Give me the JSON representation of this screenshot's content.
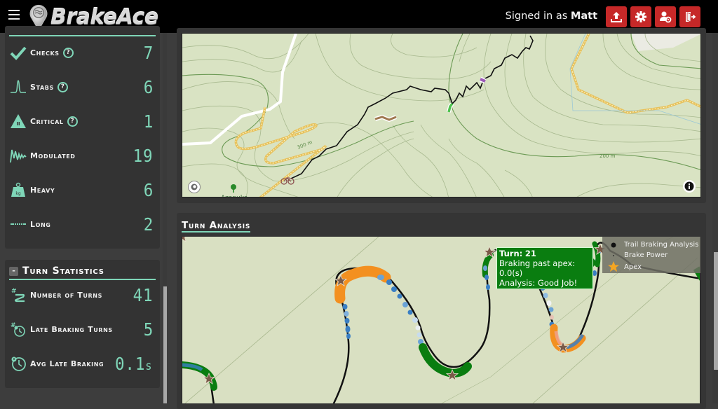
{
  "app": {
    "name": "BrakeAce",
    "signed_in_prefix": "Signed in as",
    "user": "Matt"
  },
  "toolbar": {
    "buttons": [
      {
        "name": "upload",
        "icon": "upload-icon"
      },
      {
        "name": "settings",
        "icon": "gear-icon"
      },
      {
        "name": "user-settings",
        "icon": "user-gear-icon"
      },
      {
        "name": "logout",
        "icon": "sign-out-icon"
      }
    ],
    "button_color": "#c62828"
  },
  "braking_stats": {
    "items": [
      {
        "label": "Checks",
        "value": "7",
        "icon": "checkmark-icon",
        "help": true
      },
      {
        "label": "Stabs",
        "value": "6",
        "icon": "spike-icon",
        "help": true
      },
      {
        "label": "Critical",
        "value": "1",
        "icon": "warning-icon",
        "help": true
      },
      {
        "label": "Modulated",
        "value": "19",
        "icon": "wave-icon",
        "help": false
      },
      {
        "label": "Heavy",
        "value": "6",
        "icon": "weight-kg-icon",
        "help": false
      },
      {
        "label": "Long",
        "value": "2",
        "icon": "dashed-line-icon",
        "help": false
      }
    ]
  },
  "turn_statistics": {
    "title": "Turn Statistics",
    "collapse_label": "-",
    "items": [
      {
        "label": "Number of Turns",
        "value": "41",
        "icon": "turns-count-icon"
      },
      {
        "label": "Late Braking Turns",
        "value": "5",
        "icon": "late-turns-icon"
      },
      {
        "label": "Avg Late Braking",
        "value": "0.1",
        "unit": "s",
        "icon": "clock-alert-icon"
      }
    ]
  },
  "map": {
    "contour_labels": [
      "300 m",
      "200 m"
    ],
    "place_label": "Azapuka"
  },
  "turn_analysis": {
    "title": "Turn Analysis",
    "tooltip": {
      "turn_label": "Turn:",
      "turn_value": "21",
      "braking_label": "Braking past apex:",
      "braking_value": "0.0(s)",
      "analysis_label": "Analysis:",
      "analysis_value": "Good Job!"
    },
    "legend": [
      {
        "label": "Trail Braking Analysis",
        "symbol": "dot"
      },
      {
        "label": "Brake Power",
        "symbol": "small-dot"
      },
      {
        "label": "Apex",
        "symbol": "star",
        "color": "#f5a623"
      }
    ]
  },
  "colors": {
    "accent": "#7fd6b8",
    "good": "#0a7d10",
    "late": "#f39020",
    "brake_blue": "#3a7fc4",
    "apex_star": "#7a5a48"
  }
}
